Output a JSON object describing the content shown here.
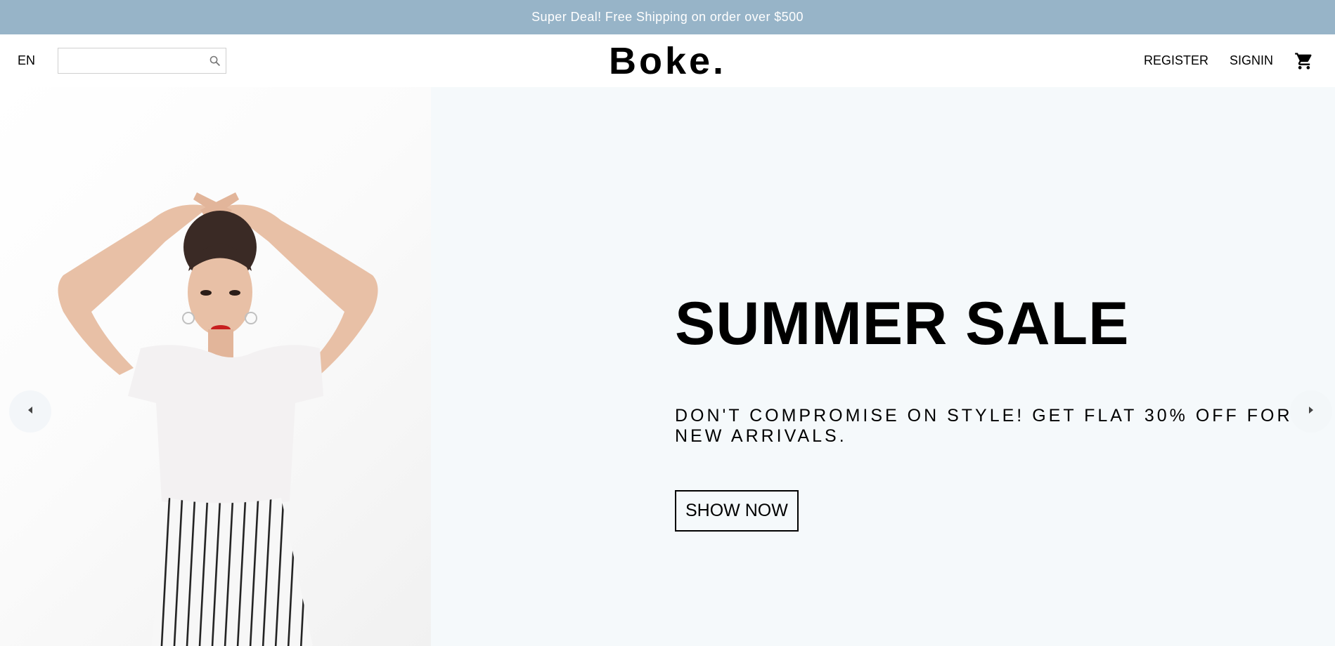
{
  "announcement": {
    "text": "Super Deal! Free Shipping on order over $500"
  },
  "navbar": {
    "language": "EN",
    "search": {
      "value": "",
      "placeholder": "",
      "icon": "search-icon"
    },
    "logo": "Boke.",
    "links": {
      "register": "REGISTER",
      "signin": "SIGNIN"
    },
    "cart_icon": "shopping-cart-icon"
  },
  "slider": {
    "title": "SUMMER SALE",
    "description": "DON'T COMPROMISE ON STYLE! GET FLAT 30% OFF FOR NEW ARRIVALS.",
    "button": "SHOW NOW",
    "prev_icon": "arrow-left-icon",
    "next_icon": "arrow-right-icon"
  },
  "colors": {
    "announcement_bg": "#97b4c8",
    "slide_bg": "#f5f9fb",
    "text": "#000000"
  }
}
